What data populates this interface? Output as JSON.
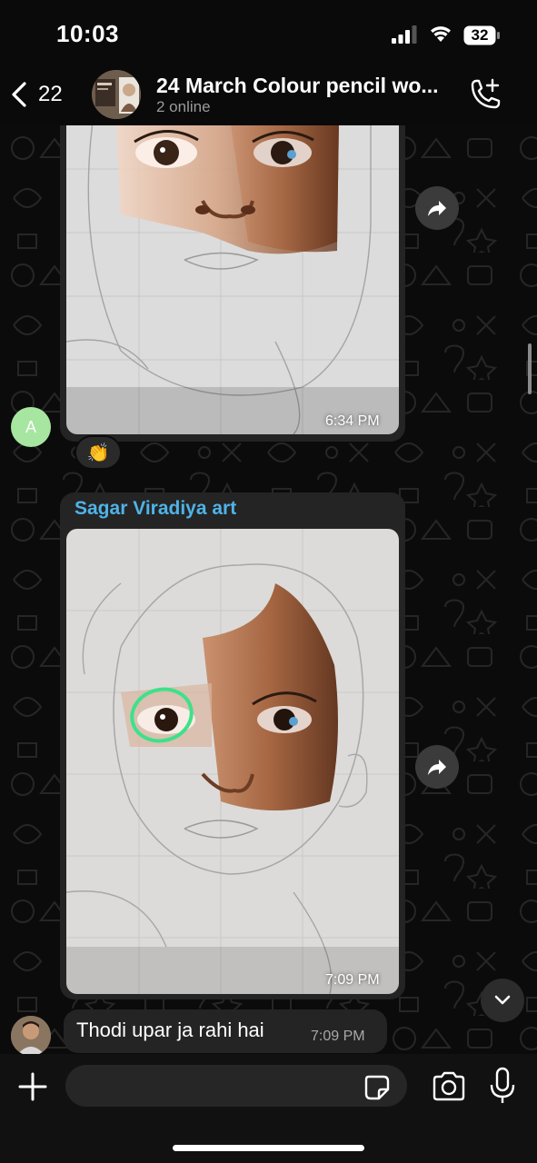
{
  "status_bar": {
    "time": "10:03",
    "battery": "32"
  },
  "header": {
    "back_count": "22",
    "title": "24 March Colour pencil wo...",
    "subtitle": "2 online"
  },
  "messages": [
    {
      "type": "photo",
      "time": "6:34 PM",
      "sender_initial": "A",
      "reaction": "👏"
    },
    {
      "type": "photo",
      "sender_name": "Sagar Viradiya art",
      "time": "7:09 PM"
    },
    {
      "type": "text",
      "text": "Thodi upar ja rahi hai",
      "time": "7:09 PM"
    }
  ],
  "input": {
    "placeholder": ""
  },
  "colors": {
    "background": "#0b0b0b",
    "bubble": "#242424",
    "sender_name": "#4fb3e8",
    "avatar_a": "#a6e6a0",
    "highlight_circle": "#3de18a"
  },
  "icons": [
    "chevron-left-icon",
    "call-add-icon",
    "forward-icon",
    "chevron-down-icon",
    "plus-icon",
    "sticker-icon",
    "camera-icon",
    "mic-icon"
  ]
}
